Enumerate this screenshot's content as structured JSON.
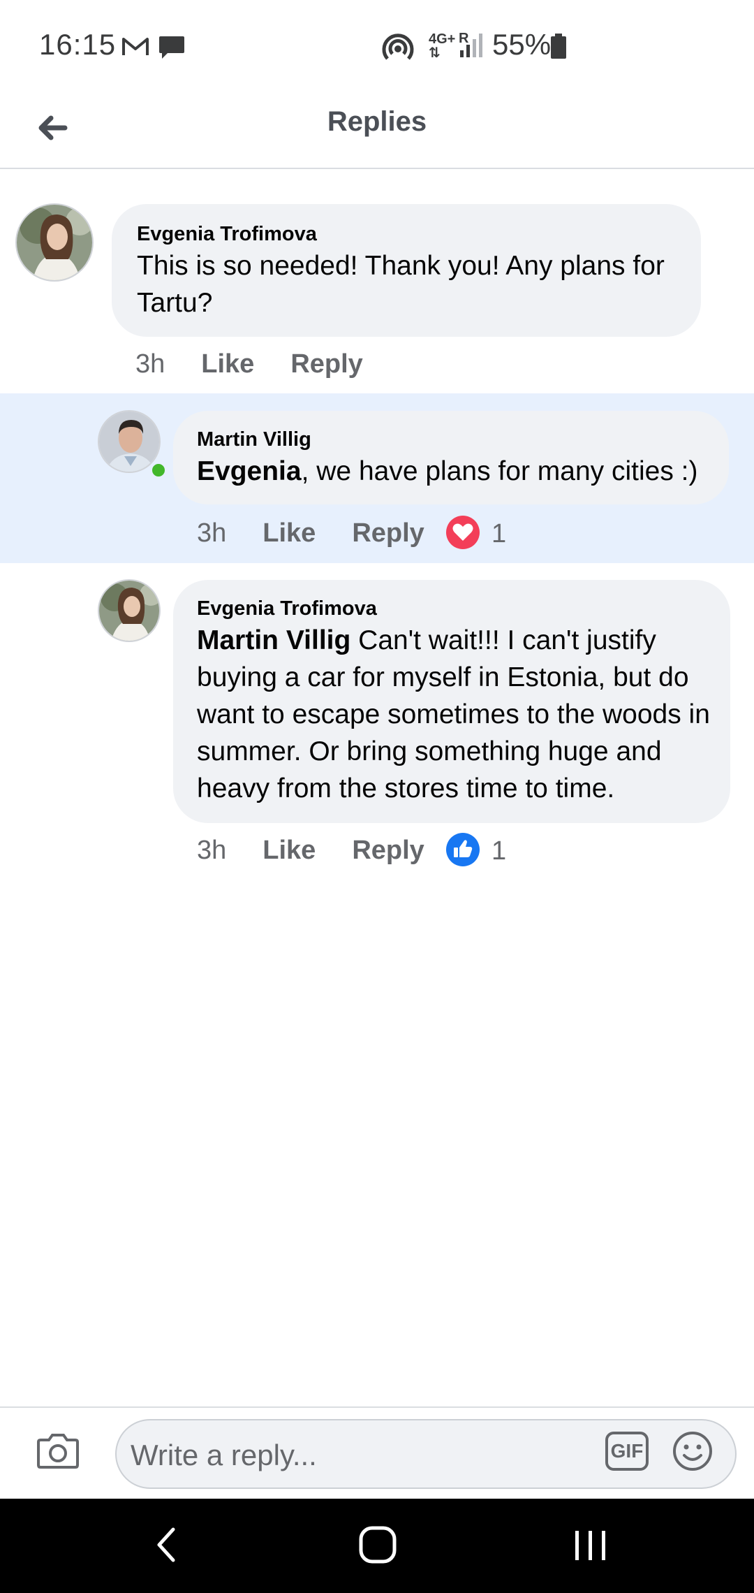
{
  "status_bar": {
    "time": "16:15",
    "network": "4G+",
    "roaming": "R",
    "battery": "55%",
    "icons": [
      "gmail-icon",
      "message-icon",
      "hotspot-icon",
      "signal-icon",
      "battery-icon"
    ]
  },
  "header": {
    "title": "Replies",
    "back_icon": "back-arrow-icon"
  },
  "comments": [
    {
      "author": "Evgenia Trofimova",
      "mention": "",
      "text": "This is so needed! Thank you! Any plans for Tartu?",
      "time": "3h",
      "like_label": "Like",
      "reply_label": "Reply",
      "reaction": null
    },
    {
      "author": "Martin Villig",
      "mention": "Evgenia",
      "text": ", we have plans for many cities :)",
      "time": "3h",
      "like_label": "Like",
      "reply_label": "Reply",
      "reaction": {
        "icon": "love-reaction-icon",
        "count": "1",
        "color": "#f33e58"
      },
      "online": true
    },
    {
      "author": "Evgenia Trofimova",
      "mention": "Martin Villig",
      "text": " Can't wait!!! I can't justify buying a car for myself in Estonia, but do want to escape sometimes to the woods in summer. Or bring something huge and heavy from the stores time to time.",
      "time": "3h",
      "like_label": "Like",
      "reply_label": "Reply",
      "reaction": {
        "icon": "like-reaction-icon",
        "count": "1",
        "color": "#1877f2"
      }
    }
  ],
  "composer": {
    "placeholder": "Write a reply...",
    "gif_label": "GIF",
    "icons": [
      "camera-icon",
      "gif-icon",
      "emoji-icon"
    ]
  },
  "nav_bar": {
    "icons": [
      "nav-back-icon",
      "nav-home-icon",
      "nav-recents-icon"
    ]
  },
  "colors": {
    "highlight": "#e7f0fd",
    "bubble": "#f0f2f5",
    "online": "#42b72a",
    "love": "#f33e58",
    "like": "#1877f2"
  }
}
